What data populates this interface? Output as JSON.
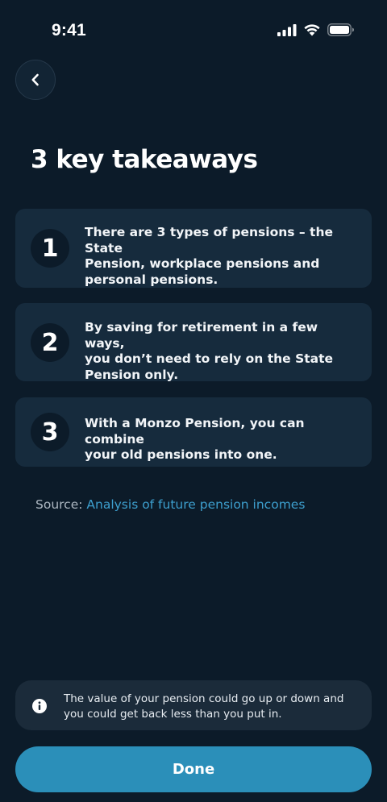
{
  "status_bar": {
    "time": "9:41",
    "icons": [
      "signal-icon",
      "wifi-icon",
      "battery-icon"
    ]
  },
  "header": {
    "back_icon": "chevron-left-icon",
    "title": "3 key takeaways"
  },
  "takeaways": [
    {
      "number": "1",
      "lines": [
        "There are 3 types of pensions – the State",
        "Pension, workplace pensions and",
        "personal pensions."
      ]
    },
    {
      "number": "2",
      "lines": [
        "By saving for retirement in a few ways,",
        "you don’t need to rely on the State",
        "Pension only."
      ]
    },
    {
      "number": "3",
      "lines": [
        "With a Monzo Pension, you can combine",
        "your old pensions into one."
      ]
    }
  ],
  "source": {
    "label": "Source:",
    "link_text": "Analysis of future pension incomes"
  },
  "notice": {
    "icon": "info-icon",
    "lines": [
      "The value of your pension could go up or down and",
      "you could get back less than you put in."
    ]
  },
  "actions": {
    "done_label": "Done"
  },
  "colors": {
    "background": "#0c1b29",
    "card": "#162b3d",
    "accent": "#2b8fb9",
    "link": "#3d9fce"
  }
}
